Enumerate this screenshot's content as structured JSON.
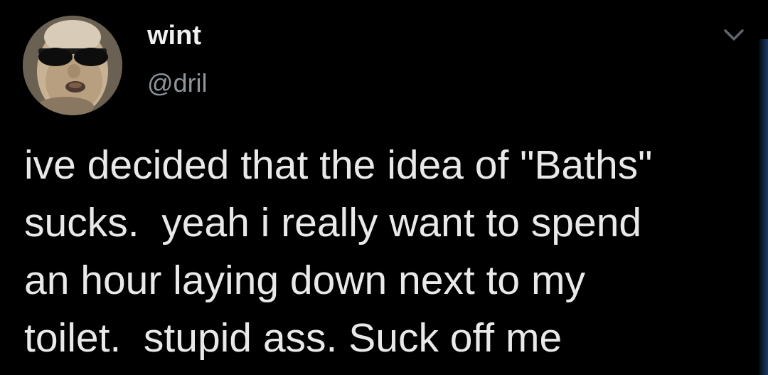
{
  "tweet": {
    "author": {
      "display_name": "wint",
      "handle": "@dril",
      "avatar_icon": "profile-photo"
    },
    "menu_icon": "chevron-down-icon",
    "text_lines": [
      "ive decided that the idea of \"Baths\"",
      "sucks.  yeah i really want to spend",
      "an hour laying down next to my",
      "toilet.  stupid ass. Suck off me"
    ]
  },
  "colors": {
    "background": "#000000",
    "display_name": "#f0f0f0",
    "handle": "#8f959b",
    "body_text": "#e9e9e9",
    "edge_accent": "#1b3a63"
  }
}
